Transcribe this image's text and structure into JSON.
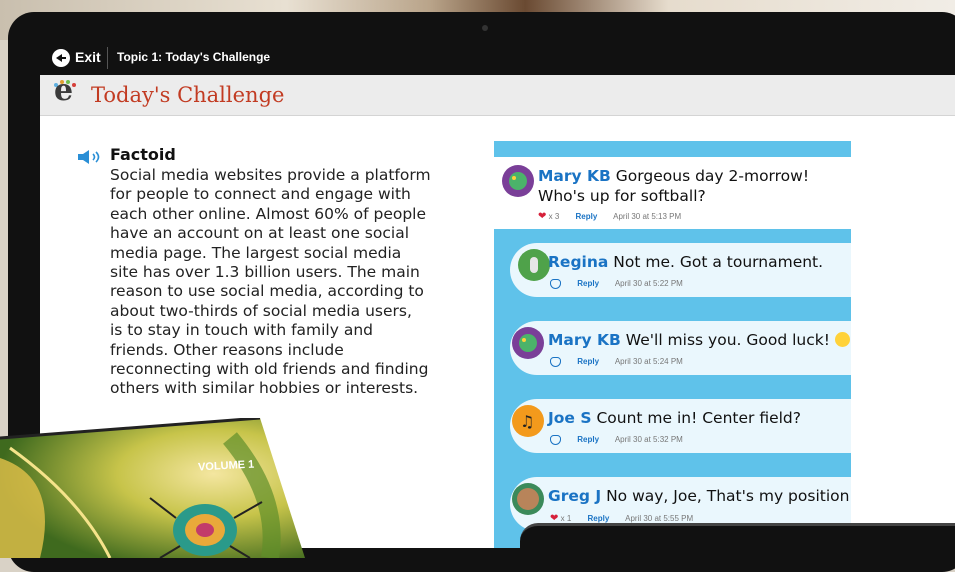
{
  "topbar": {
    "exit_label": "Exit",
    "topic": "Topic 1: Today's Challenge"
  },
  "header": {
    "title": "Today's Challenge"
  },
  "factoid": {
    "title": "Factoid",
    "lines": [
      "Social media websites provide a platform",
      "for people to connect and engage with",
      "each other online. Almost 60% of people",
      "have an account on at least one social",
      "media page. The largest social media",
      "site has over 1.3 billion users. The main",
      "reason to use social media, according to",
      "about two-thirds of social media users,",
      "is to stay in touch with family and",
      "friends. Other reasons include",
      "reconnecting with old friends and finding",
      "others with similar hobbies or interests."
    ]
  },
  "chat": {
    "main_post": {
      "name": "Mary KB",
      "text_line1": "Gorgeous day 2-morrow!",
      "text_line2": "Who's up for softball?",
      "likes": "x 3",
      "reply_label": "Reply",
      "time": "April 30 at 5:13 PM"
    },
    "replies": [
      {
        "name": "Regina",
        "text": "Not me. Got a tournament.",
        "reply_label": "Reply",
        "time": "April 30 at 5:22 PM",
        "likes": ""
      },
      {
        "name": "Mary KB",
        "text": "We'll miss you. Good luck!",
        "reply_label": "Reply",
        "time": "April 30 at 5:24 PM",
        "likes": ""
      },
      {
        "name": "Joe S",
        "text": "Count me in! Center field?",
        "reply_label": "Reply",
        "time": "April 30 at 5:32 PM",
        "likes": ""
      },
      {
        "name": "Greg J",
        "text": "No way, Joe, That's my position!",
        "reply_label": "Reply",
        "time": "April 30 at 5:55 PM",
        "likes": "x 1"
      }
    ]
  },
  "book": {
    "label": "VOLUME 1"
  },
  "colors": {
    "accent_title": "#c23b22",
    "chat_bg": "#5fc2ea",
    "name_blue": "#1a73c4",
    "heart_red": "#d6203a"
  }
}
